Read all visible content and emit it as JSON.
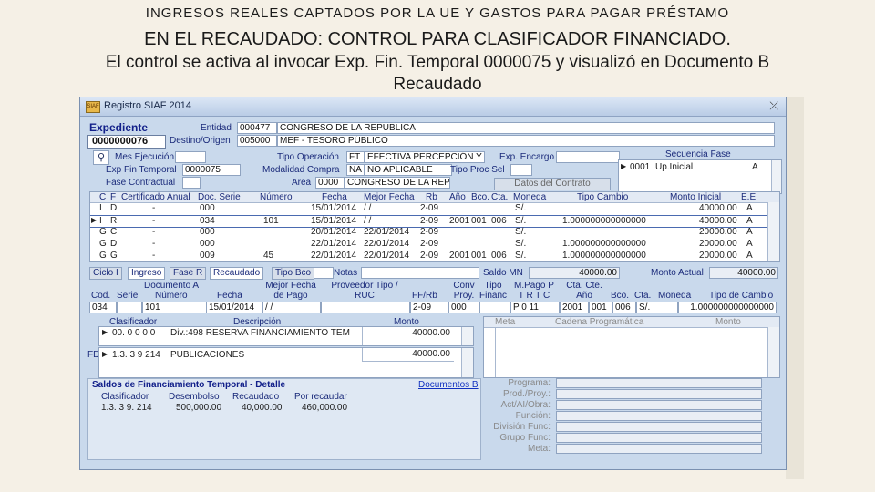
{
  "slide": {
    "heading": "INGRESOS REALES CAPTADOS POR LA UE Y GASTOS PARA PAGAR PRÉSTAMO",
    "line2": "EN EL RECAUDADO: CONTROL PARA CLASIFICADOR FINANCIADO.",
    "line3": "El control se activa al invocar Exp. Fin. Temporal 0000075 y visualizó en Documento B",
    "line4": "Recaudado"
  },
  "window": {
    "title": "Registro SIAF 2014",
    "app_icon": "SIAF",
    "close_icon": "close-icon"
  },
  "header": {
    "expediente_label": "Expediente",
    "expediente_value": "0000000076",
    "entidad_label": "Entidad",
    "entidad_code": "000477",
    "entidad_name": "CONGRESO DE LA REPUBLICA",
    "destino_label": "Destino/Origen",
    "destino_code": "005000",
    "destino_name": "MEF - TESORO PÚBLICO",
    "mes_label": "Mes Ejecución",
    "tipo_op_label": "Tipo Operación",
    "tipo_op_code": "FT",
    "tipo_op_value": "EFECTIVA PERCEPCIÓN Y",
    "exp_encargo_label": "Exp. Encargo",
    "exp_fin_label": "Exp Fin Temporal",
    "exp_fin_value": "0000075",
    "modalidad_label": "Modalidad Compra",
    "modalidad_code": "NA",
    "modalidad_value": "NO APLICABLE",
    "tipo_proc_label": "Tipo Proc Sel",
    "fase_label": "Fase Contractual",
    "area_label": "Area",
    "area_code": "0000",
    "area_value": "CONGRESO DE LA REPUBLICA",
    "datos_contrato_btn": "Datos del Contrato",
    "secuencia_label": "Secuencia Fase",
    "secuencia_rows": [
      {
        "code": "0001",
        "name": "Up.Inicial",
        "flag": "A"
      }
    ]
  },
  "fases_table": {
    "columns": [
      "C",
      "F",
      "Certificado Anual",
      "Doc. Serie",
      "Número",
      "Fecha",
      "Mejor Fecha",
      "Rb",
      "Año",
      "Bco.",
      "Cta.",
      "Moneda",
      "Tipo Cambio",
      "Monto Inicial",
      "E.E."
    ],
    "rows": [
      {
        "c": "I",
        "f": "D",
        "cert": "-",
        "serie": "000",
        "num": "",
        "fecha": "15/01/2014",
        "mejor": "/ /",
        "rb": "2-09",
        "anio": "",
        "bco": "",
        "cta": "",
        "moneda": "S/.",
        "tc": "",
        "monto": "40000.00",
        "ee": "A"
      },
      {
        "c": "I",
        "f": "R",
        "cert": "-",
        "serie": "034",
        "num": "101",
        "fecha": "15/01/2014",
        "mejor": "/ /",
        "rb": "2-09",
        "anio": "2001",
        "bco": "001",
        "cta": "006",
        "moneda": "S/.",
        "tc": "1.000000000000000",
        "monto": "40000.00",
        "ee": "A"
      },
      {
        "c": "G",
        "f": "C",
        "cert": "-",
        "serie": "000",
        "num": "",
        "fecha": "20/01/2014",
        "mejor": "22/01/2014",
        "rb": "2-09",
        "anio": "",
        "bco": "",
        "cta": "",
        "moneda": "S/.",
        "tc": "",
        "monto": "20000.00",
        "ee": "A"
      },
      {
        "c": "G",
        "f": "D",
        "cert": "-",
        "serie": "000",
        "num": "",
        "fecha": "22/01/2014",
        "mejor": "22/01/2014",
        "rb": "2-09",
        "anio": "",
        "bco": "",
        "cta": "",
        "moneda": "S/.",
        "tc": "1.000000000000000",
        "monto": "20000.00",
        "ee": "A"
      },
      {
        "c": "G",
        "f": "G",
        "cert": "-",
        "serie": "009",
        "num": "45",
        "fecha": "22/01/2014",
        "mejor": "22/01/2014",
        "rb": "2-09",
        "anio": "2001",
        "bco": "001",
        "cta": "006",
        "moneda": "S/.",
        "tc": "1.000000000000000",
        "monto": "20000.00",
        "ee": "A"
      }
    ]
  },
  "tabs": {
    "ciclo": "Ciclo I",
    "ciclo_val": "Ingreso",
    "fase": "Fase R",
    "fase_val": "Recaudado",
    "tipo_bco": "Tipo Bco",
    "notas": "Notas",
    "saldo_label": "Saldo MN",
    "saldo_value": "40000.00",
    "monto_actual_label": "Monto Actual",
    "monto_actual_value": "40000.00"
  },
  "doc": {
    "cols": [
      "Documento A",
      "Cod.",
      "Serie",
      "Número",
      "Fecha",
      "Mejor Fecha de Pago",
      "Proveedor Tipo / RUC",
      "FF/Rb",
      "Conv Proy.",
      "Tipo Financ",
      "M.Pago P T R T C",
      "Cta. Cte. Año",
      "Bco.",
      "Cta.",
      "Moneda",
      "Tipo de Cambio"
    ],
    "row": {
      "cod": "034",
      "serie": "",
      "numero": "101",
      "fecha": "15/01/2014",
      "mejor": "/ /",
      "ffrb": "2-09",
      "conv": "000",
      "ptrtc": "P  0   11",
      "anio": "2001",
      "bco": "001",
      "cta": "006",
      "moneda": "S/.",
      "tc": "1.000000000000000"
    }
  },
  "clasificador": {
    "col_clas": "Clasificador",
    "col_desc": "Descripción",
    "col_monto": "Monto",
    "row1": {
      "clas": "00.  0  0  0  0",
      "desc": "Div.:498 RESERVA FINANCIAMIENTO TEM",
      "monto": "40000.00"
    },
    "fd_label": "FD",
    "row2": {
      "clas": "1.3.  3  9  214",
      "desc": "PUBLICACIONES",
      "monto": "40000.00"
    }
  },
  "meta_panel": {
    "col_meta": "Meta",
    "col_cadena": "Cadena Programática",
    "col_monto": "Monto",
    "fields": [
      "Programa:",
      "Prod./Proy.:",
      "Act/AI/Obra:",
      "Función:",
      "División Func:",
      "Grupo Func:",
      "Meta:"
    ]
  },
  "saldos": {
    "title": "Saldos de Financiamiento Temporal - Detalle",
    "link": "Documentos B",
    "cols": [
      "Clasificador",
      "Desembolso",
      "Recaudado",
      "Por recaudar"
    ],
    "row": {
      "clas": "1.3.  3  9.  214",
      "desembolso": "500,000.00",
      "recaudado": "40,000.00",
      "por": "460,000.00"
    }
  }
}
